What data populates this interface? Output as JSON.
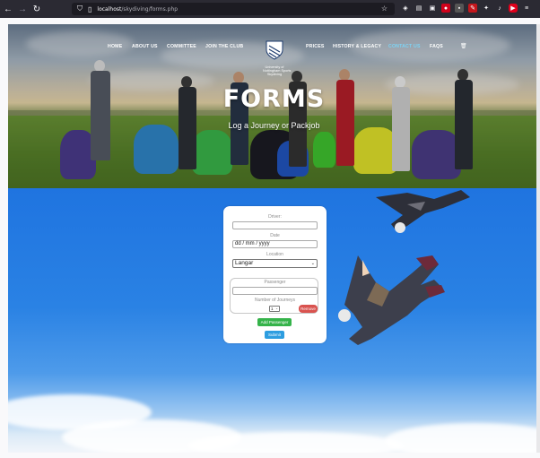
{
  "browser": {
    "url_host": "localhost",
    "url_path": "/skydiving/forms.php"
  },
  "nav": {
    "items_left": [
      "HOME",
      "ABOUT US",
      "COMMITTEE",
      "JOIN THE CLUB"
    ],
    "items_right": [
      "PRICES",
      "HISTORY & LEGACY",
      "CONTACT US",
      "FAQS"
    ],
    "active": "CONTACT US",
    "logo_lines": [
      "University of",
      "Nottingham Sports",
      "Skydiving"
    ]
  },
  "hero": {
    "title": "FORMS",
    "subtitle": "Log a Journey or Packjob"
  },
  "form": {
    "driver_label": "Driver:",
    "driver_value": "",
    "date_label": "Date",
    "date_placeholder": "dd / mm / yyyy",
    "location_label": "Location",
    "location_value": "Langar",
    "passenger_label": "Passenger",
    "passenger_value": "",
    "journeys_label": "Number of Journeys",
    "journeys_value": "1",
    "remove_label": "Remove",
    "add_passenger_label": "Add Passenger",
    "submit_label": "Submit"
  },
  "colors": {
    "active_nav": "#7dd3f5",
    "remove": "#d9534f",
    "add": "#35b34a",
    "submit": "#2d9de0"
  }
}
